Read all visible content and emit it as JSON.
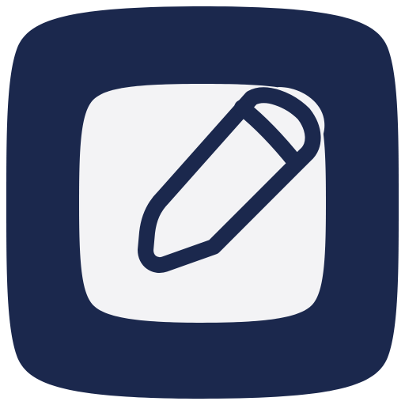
{
  "app_icon": {
    "icon_name": "edit-pencil-icon",
    "colors": {
      "background": "#1B284D",
      "tile": "#F3F3F5",
      "pencil_stroke": "#1B284D",
      "pencil_cap": "#F3F3F5"
    }
  }
}
